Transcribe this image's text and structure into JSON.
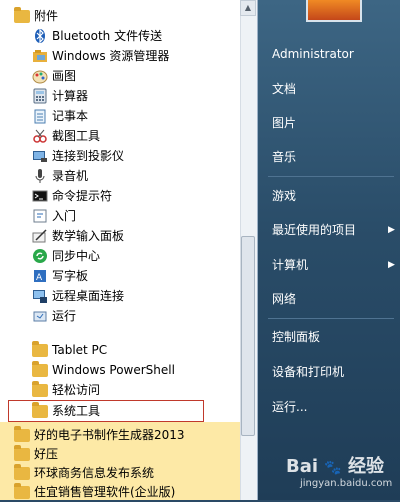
{
  "left_menu": {
    "header": "附件",
    "items": [
      {
        "label": "Bluetooth 文件传送",
        "icon": "bluetooth-icon"
      },
      {
        "label": "Windows 资源管理器",
        "icon": "explorer-icon"
      },
      {
        "label": "画图",
        "icon": "paint-icon"
      },
      {
        "label": "计算器",
        "icon": "calculator-icon"
      },
      {
        "label": "记事本",
        "icon": "notepad-icon"
      },
      {
        "label": "截图工具",
        "icon": "snipping-tool-icon"
      },
      {
        "label": "连接到投影仪",
        "icon": "projector-icon"
      },
      {
        "label": "录音机",
        "icon": "microphone-icon"
      },
      {
        "label": "命令提示符",
        "icon": "cmd-icon"
      },
      {
        "label": "入门",
        "icon": "getting-started-icon"
      },
      {
        "label": "数学输入面板",
        "icon": "math-input-icon"
      },
      {
        "label": "同步中心",
        "icon": "sync-center-icon"
      },
      {
        "label": "写字板",
        "icon": "wordpad-icon"
      },
      {
        "label": "远程桌面连接",
        "icon": "remote-desktop-icon"
      },
      {
        "label": "运行",
        "icon": "run-icon"
      },
      {
        "label": "Tablet PC",
        "icon": "folder-icon"
      },
      {
        "label": "Windows PowerShell",
        "icon": "folder-icon"
      },
      {
        "label": "轻松访问",
        "icon": "folder-icon"
      },
      {
        "label": "系统工具",
        "icon": "folder-icon"
      }
    ],
    "highlighted_folders": [
      {
        "label": "好的电子书制作生成器2013"
      },
      {
        "label": "好压"
      },
      {
        "label": "环球商务信息发布系统"
      },
      {
        "label": "住宜销售管理软件(企业版)"
      }
    ]
  },
  "right_menu": {
    "user": "Administrator",
    "items": [
      {
        "label": "文档",
        "has_arrow": false
      },
      {
        "label": "图片",
        "has_arrow": false
      },
      {
        "label": "音乐",
        "has_arrow": false
      },
      {
        "label": "游戏",
        "has_arrow": false
      },
      {
        "label": "最近使用的项目",
        "has_arrow": true
      },
      {
        "label": "计算机",
        "has_arrow": true
      },
      {
        "label": "网络",
        "has_arrow": false
      },
      {
        "label": "控制面板",
        "has_arrow": false
      },
      {
        "label": "设备和打印机",
        "has_arrow": false
      },
      {
        "label": "运行...",
        "has_arrow": false
      }
    ]
  },
  "watermark": {
    "brand": "Bai",
    "brand2": "经验",
    "url": "jingyan.baidu.com"
  },
  "colors": {
    "highlight": "#fde9a6",
    "selection_border": "#c0392b",
    "right_panel": "#2a4d69"
  }
}
